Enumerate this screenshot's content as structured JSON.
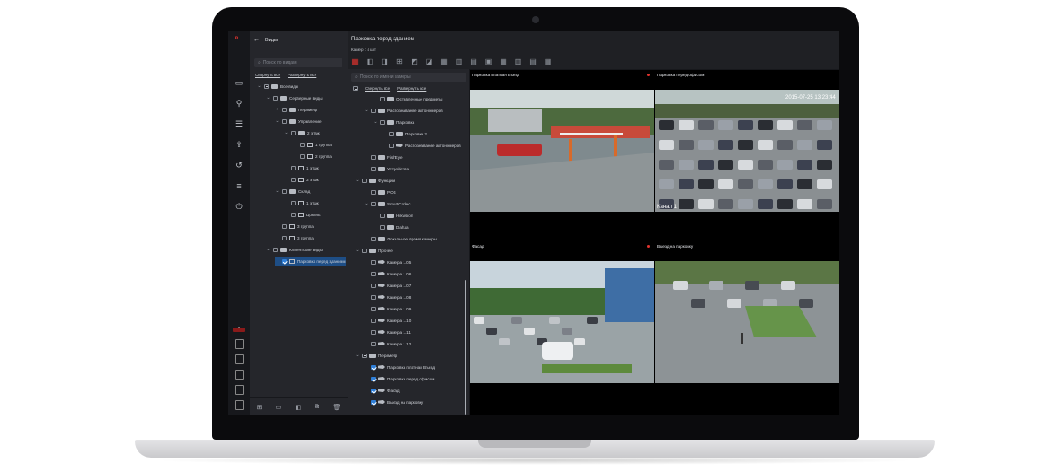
{
  "views_panel": {
    "title": "Виды",
    "search_placeholder": "Поиск по видам",
    "collapse_all": "Свернуть все",
    "expand_all": "Развернуть все",
    "tree": [
      {
        "label": "Все виды",
        "indent": 0,
        "toggle": "v",
        "check": "part",
        "icon": "folder"
      },
      {
        "label": "Серверные виды",
        "indent": 1,
        "toggle": "v",
        "check": "off",
        "icon": "folder"
      },
      {
        "label": "Периметр",
        "indent": 2,
        "toggle": ">",
        "check": "off",
        "icon": "folder"
      },
      {
        "label": "Управление",
        "indent": 2,
        "toggle": "v",
        "check": "off",
        "icon": "folder"
      },
      {
        "label": "2 этаж",
        "indent": 3,
        "toggle": "v",
        "check": "off",
        "icon": "folder"
      },
      {
        "label": "1 группа",
        "indent": 4,
        "toggle": "",
        "check": "off",
        "icon": "grid"
      },
      {
        "label": "2 группа",
        "indent": 4,
        "toggle": "",
        "check": "off",
        "icon": "grid"
      },
      {
        "label": "1 этаж",
        "indent": 3,
        "toggle": "",
        "check": "off",
        "icon": "grid"
      },
      {
        "label": "3 этаж",
        "indent": 3,
        "toggle": "",
        "check": "off",
        "icon": "grid"
      },
      {
        "label": "Склад",
        "indent": 2,
        "toggle": "v",
        "check": "off",
        "icon": "folder"
      },
      {
        "label": "1 этаж",
        "indent": 3,
        "toggle": "",
        "check": "off",
        "icon": "grid"
      },
      {
        "label": "Цоколь",
        "indent": 3,
        "toggle": "",
        "check": "off",
        "icon": "grid"
      },
      {
        "label": "3 группа",
        "indent": 2,
        "toggle": "",
        "check": "off",
        "icon": "grid"
      },
      {
        "label": "3 группа",
        "indent": 2,
        "toggle": "",
        "check": "off",
        "icon": "grid"
      },
      {
        "label": "Клиентские виды",
        "indent": 1,
        "toggle": "v",
        "check": "off",
        "icon": "folder"
      },
      {
        "label": "Парковка перед зданием",
        "indent": 2,
        "toggle": "",
        "check": "on",
        "icon": "grid",
        "selected": true
      }
    ],
    "footer_icons": [
      "add-view-icon",
      "add-folder-icon",
      "camera-layout-icon",
      "copy-icon",
      "delete-icon"
    ]
  },
  "rail": {
    "logo": "»",
    "icons": [
      {
        "name": "monitor-icon",
        "glyph": "▭"
      },
      {
        "name": "map-pin-icon",
        "glyph": "⚲"
      },
      {
        "name": "list-icon",
        "glyph": "☰"
      },
      {
        "name": "export-icon",
        "glyph": "⇪"
      },
      {
        "name": "history-icon",
        "glyph": "↺"
      },
      {
        "name": "settings-sliders-icon",
        "glyph": "≡"
      },
      {
        "name": "power-icon",
        "glyph": "⏻"
      }
    ],
    "collapse_label": "^"
  },
  "header": {
    "title": "Парковка перед зданием",
    "camera_count": "Камер : 4 шт"
  },
  "camera_panel": {
    "search_placeholder": "Поиск по имени камеры",
    "collapse_all": "Свернуть все",
    "expand_all": "Развернуть все",
    "tree": [
      {
        "label": "Оставленные предметы",
        "indent": 2,
        "toggle": "",
        "check": "off",
        "icon": "folder"
      },
      {
        "label": "Распознавание автономеров",
        "indent": 1,
        "toggle": "v",
        "check": "off",
        "icon": "folder"
      },
      {
        "label": "Парковка",
        "indent": 2,
        "toggle": "v",
        "check": "off",
        "icon": "folder"
      },
      {
        "label": "Парковка 2",
        "indent": 3,
        "toggle": "",
        "check": "off",
        "icon": "folder"
      },
      {
        "label": "Распознавание автономеров",
        "indent": 3,
        "toggle": "",
        "check": "off",
        "icon": "camera"
      },
      {
        "label": "FishEye",
        "indent": 1,
        "toggle": "",
        "check": "off",
        "icon": "folder"
      },
      {
        "label": "Устройства",
        "indent": 1,
        "toggle": "",
        "check": "off",
        "icon": "folder"
      },
      {
        "label": "Функции",
        "indent": 0,
        "toggle": "v",
        "check": "off",
        "icon": "folder"
      },
      {
        "label": "POS",
        "indent": 1,
        "toggle": "",
        "check": "off",
        "icon": "folder"
      },
      {
        "label": "SmartCodec",
        "indent": 1,
        "toggle": "v",
        "check": "off",
        "icon": "folder"
      },
      {
        "label": "Hikvision",
        "indent": 2,
        "toggle": "",
        "check": "off",
        "icon": "folder"
      },
      {
        "label": "Dahua",
        "indent": 2,
        "toggle": "",
        "check": "off",
        "icon": "folder"
      },
      {
        "label": "Локальное время камеры",
        "indent": 1,
        "toggle": "",
        "check": "off",
        "icon": "folder"
      },
      {
        "label": "Прочее",
        "indent": 0,
        "toggle": "v",
        "check": "off",
        "icon": "folder"
      },
      {
        "label": "Камера 1.05",
        "indent": 1,
        "toggle": "",
        "check": "off",
        "icon": "camera"
      },
      {
        "label": "Камера 1.06",
        "indent": 1,
        "toggle": "",
        "check": "off",
        "icon": "camera"
      },
      {
        "label": "Камера 1.07",
        "indent": 1,
        "toggle": "",
        "check": "off",
        "icon": "camera"
      },
      {
        "label": "Камера 1.08",
        "indent": 1,
        "toggle": "",
        "check": "off",
        "icon": "camera"
      },
      {
        "label": "Камера 1.09",
        "indent": 1,
        "toggle": "",
        "check": "off",
        "icon": "camera"
      },
      {
        "label": "Камера 1.10",
        "indent": 1,
        "toggle": "",
        "check": "off",
        "icon": "camera"
      },
      {
        "label": "Камера 1.11",
        "indent": 1,
        "toggle": "",
        "check": "off",
        "icon": "camera"
      },
      {
        "label": "Камера 1.12",
        "indent": 1,
        "toggle": "",
        "check": "off",
        "icon": "camera"
      },
      {
        "label": "Периметр",
        "indent": 0,
        "toggle": "v",
        "check": "part",
        "icon": "folder"
      },
      {
        "label": "Парковка платная Въезд",
        "indent": 1,
        "toggle": "",
        "check": "on",
        "icon": "camera"
      },
      {
        "label": "Парковка перед офисом",
        "indent": 1,
        "toggle": "",
        "check": "on",
        "icon": "camera"
      },
      {
        "label": "Фасад",
        "indent": 1,
        "toggle": "",
        "check": "on",
        "icon": "camera"
      },
      {
        "label": "Выезд на парковку",
        "indent": 1,
        "toggle": "",
        "check": "on",
        "icon": "camera"
      }
    ]
  },
  "layout_icons": [
    "layout-1x1-icon",
    "layout-1-2-icon",
    "layout-1-3-icon",
    "layout-2x2-icon",
    "layout-1-5-icon",
    "layout-1-7-icon",
    "layout-3x3-icon",
    "layout-1-8-icon",
    "layout-2-8-icon",
    "layout-1-12-icon",
    "layout-4x4-icon",
    "layout-2-10-icon",
    "layout-3-12-icon",
    "layout-5x5-icon"
  ],
  "video_tiles": [
    {
      "title": "Парковка платная Въезд",
      "alert": false,
      "scene": "gate"
    },
    {
      "title": "Парковка перед офисом",
      "alert": true,
      "scene": "lot",
      "overlay": "2015-07-25 13:23:44",
      "caption": "Канал 1"
    },
    {
      "title": "Фасад",
      "alert": false,
      "scene": "facade"
    },
    {
      "title": "Выезд на парковку",
      "alert": true,
      "scene": "exit"
    }
  ],
  "colors": {
    "accent": "#2f7fd8",
    "alert": "#e0332e",
    "brand": "#d8322e"
  }
}
